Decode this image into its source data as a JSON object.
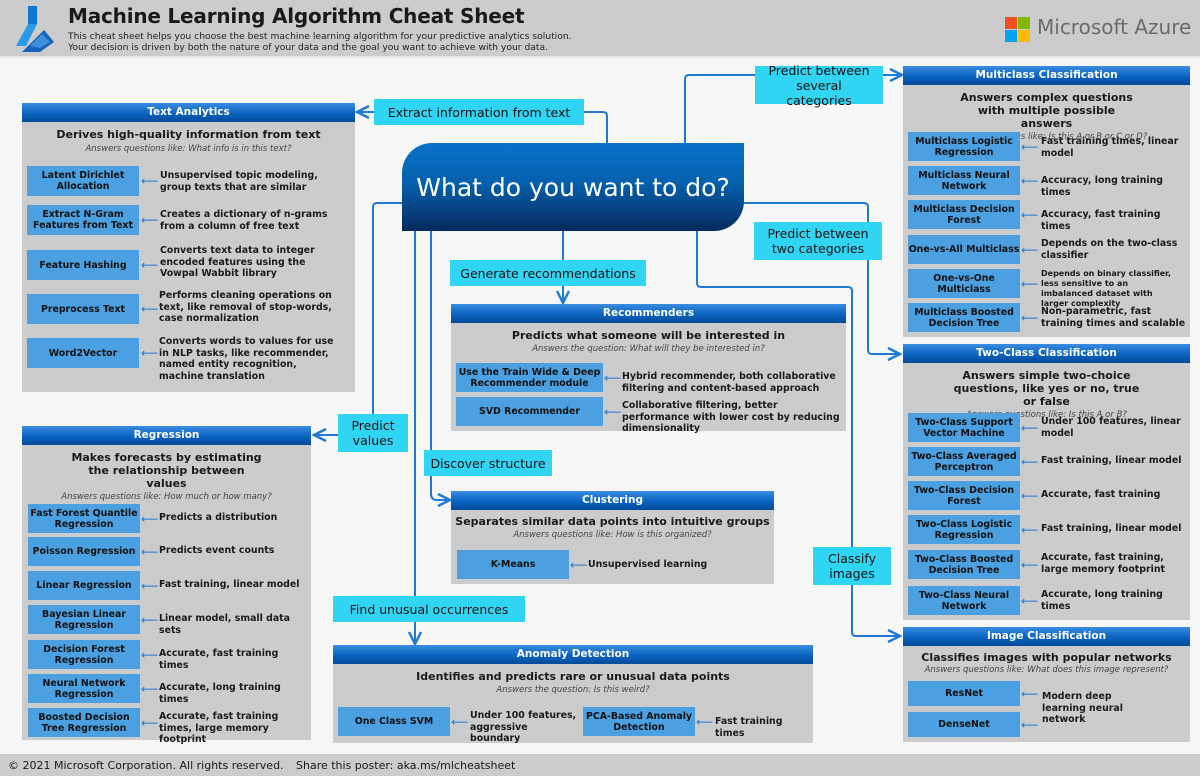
{
  "header": {
    "title": "Machine Learning Algorithm Cheat Sheet",
    "subtitle_line1": "This cheat sheet helps you choose the best machine learning algorithm for your predictive analytics solution.",
    "subtitle_line2": "Your decision is driven by both the nature of your data and the goal you want to achieve with your data.",
    "brand": "Microsoft Azure",
    "brand_colors": [
      "#f25022",
      "#7fba00",
      "#00a4ef",
      "#ffb900"
    ]
  },
  "center": {
    "question": "What do you want to do?"
  },
  "goals": {
    "extract_text": "Extract information from text",
    "several_categories": "Predict between several categories",
    "two_categories": "Predict between two categories",
    "recommendations": "Generate recommendations",
    "predict_values": "Predict values",
    "discover_structure": "Discover structure",
    "find_unusual": "Find unusual occurrences",
    "classify_images": "Classify images"
  },
  "panels": {
    "text_analytics": {
      "title": "Text Analytics",
      "desc": "Derives high-quality information from text",
      "question": "Answers questions like: What info is in this text?",
      "algorithms": [
        {
          "name": "Latent Dirichlet Allocation",
          "note": "Unsupervised topic modeling, group texts that are similar"
        },
        {
          "name": "Extract N-Gram Features from Text",
          "note": "Creates a dictionary of n-grams from a column of free text"
        },
        {
          "name": "Feature Hashing",
          "note": "Converts text data to integer encoded features using the Vowpal Wabbit library"
        },
        {
          "name": "Preprocess Text",
          "note": "Performs cleaning operations on text, like removal of stop-words, case normalization"
        },
        {
          "name": "Word2Vector",
          "note": "Converts words to values for use in NLP tasks, like recommender, named entity recognition, machine translation"
        }
      ]
    },
    "regression": {
      "title": "Regression",
      "desc": "Makes forecasts by estimating the relationship between values",
      "question": "Answers questions like: How much or how many?",
      "algorithms": [
        {
          "name": "Fast Forest Quantile Regression",
          "note": "Predicts a distribution"
        },
        {
          "name": "Poisson Regression",
          "note": "Predicts event counts"
        },
        {
          "name": "Linear Regression",
          "note": "Fast training, linear model"
        },
        {
          "name": "Bayesian Linear Regression",
          "note": "Linear model, small data sets"
        },
        {
          "name": "Decision Forest Regression",
          "note": "Accurate, fast training times"
        },
        {
          "name": "Neural Network Regression",
          "note": "Accurate, long training times"
        },
        {
          "name": "Boosted Decision Tree Regression",
          "note": "Accurate, fast training times, large memory footprint"
        }
      ]
    },
    "recommenders": {
      "title": "Recommenders",
      "desc": "Predicts what someone will be interested in",
      "question": "Answers the question: What will they be interested in?",
      "algorithms": [
        {
          "name": "Use the Train Wide & Deep Recommender module",
          "note": "Hybrid recommender, both collaborative filtering and content-based approach"
        },
        {
          "name": "SVD Recommender",
          "note": "Collaborative filtering, better performance with lower cost by reducing dimensionality"
        }
      ]
    },
    "clustering": {
      "title": "Clustering",
      "desc": "Separates similar data points into intuitive groups",
      "question": "Answers questions like: How is this organized?",
      "algorithms": [
        {
          "name": "K-Means",
          "note": "Unsupervised learning"
        }
      ]
    },
    "anomaly": {
      "title": "Anomaly Detection",
      "desc": "Identifies and predicts rare or unusual data points",
      "question": "Answers the question: Is this weird?",
      "algorithms": [
        {
          "name": "One Class SVM",
          "note": "Under 100 features, aggressive boundary"
        },
        {
          "name": "PCA-Based Anomaly Detection",
          "note": "Fast training times"
        }
      ]
    },
    "multiclass": {
      "title": "Multiclass Classification",
      "desc": "Answers complex questions with multiple possible answers",
      "question": "Answers questions like: Is this A or B or C or D?",
      "algorithms": [
        {
          "name": "Multiclass Logistic Regression",
          "note": "Fast training times, linear model"
        },
        {
          "name": "Multiclass Neural Network",
          "note": "Accuracy, long training times"
        },
        {
          "name": "Multiclass Decision Forest",
          "note": "Accuracy, fast training times"
        },
        {
          "name": "One-vs-All Multiclass",
          "note": "Depends on the two-class classifier"
        },
        {
          "name": "One-vs-One Multiclass",
          "note": "Depends on binary classifier, less sensitive to an imbalanced dataset with larger complexity"
        },
        {
          "name": "Multiclass Boosted Decision Tree",
          "note": "Non-parametric, fast training times and scalable"
        }
      ]
    },
    "twoclass": {
      "title": "Two-Class Classification",
      "desc": "Answers simple two-choice questions, like yes or no, true or false",
      "question": "Answers questions like: Is this A or B?",
      "algorithms": [
        {
          "name": "Two-Class Support Vector Machine",
          "note": "Under 100 features, linear model"
        },
        {
          "name": "Two-Class Averaged Perceptron",
          "note": "Fast training, linear model"
        },
        {
          "name": "Two-Class Decision Forest",
          "note": "Accurate, fast training"
        },
        {
          "name": "Two-Class Logistic Regression",
          "note": "Fast training, linear model"
        },
        {
          "name": "Two-Class Boosted Decision Tree",
          "note": "Accurate, fast training, large memory footprint"
        },
        {
          "name": "Two-Class Neural Network",
          "note": "Accurate, long training times"
        }
      ]
    },
    "image": {
      "title": "Image Classification",
      "desc": "Classifies images with popular networks",
      "question": "Answers questions like: What does this image represent?",
      "algorithms": [
        {
          "name": "ResNet"
        },
        {
          "name": "DenseNet"
        }
      ],
      "shared_note": "Modern deep learning neural network"
    }
  },
  "footer": {
    "copyright": "© 2021 Microsoft Corporation. All rights reserved.",
    "share": "Share this poster: aka.ms/mlcheatsheet"
  }
}
